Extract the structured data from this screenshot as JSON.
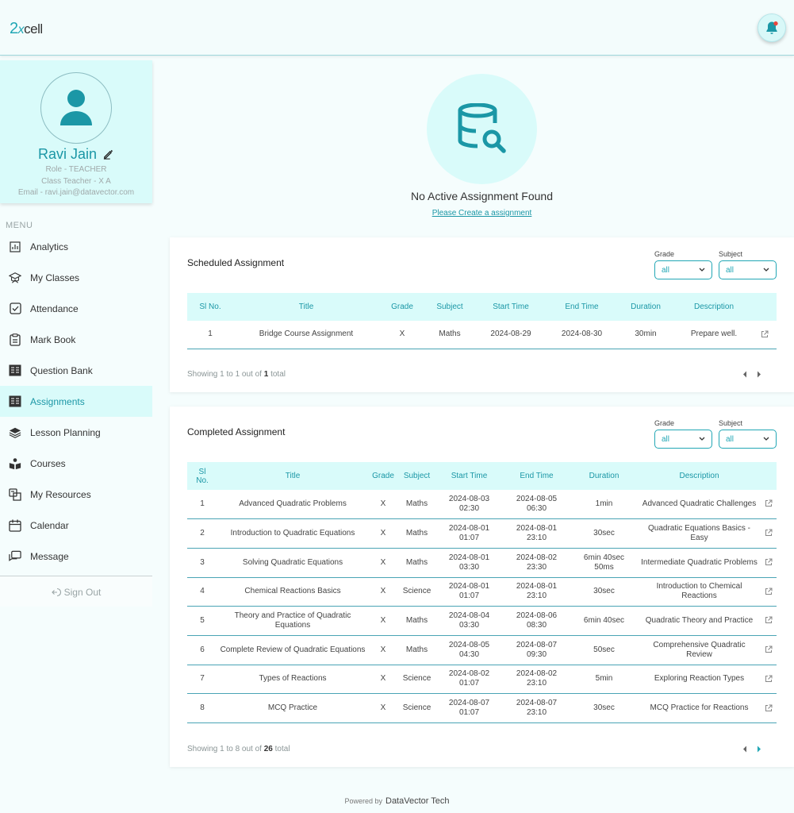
{
  "brand": {
    "logo_two": "2",
    "logo_x": "x",
    "logo_cell": "cell"
  },
  "header": {
    "notification_icon": "bell-icon"
  },
  "profile": {
    "name": "Ravi Jain",
    "role": "Role - TEACHER",
    "class_teacher": "Class Teacher - X A",
    "email": "Email - ravi.jain@datavector.com"
  },
  "menu": {
    "label": "MENU",
    "items": [
      {
        "label": "Analytics",
        "icon": "chart-icon"
      },
      {
        "label": "My Classes",
        "icon": "graduation-cap-icon"
      },
      {
        "label": "Attendance",
        "icon": "checkbox-icon"
      },
      {
        "label": "Mark Book",
        "icon": "clipboard-icon"
      },
      {
        "label": "Question Bank",
        "icon": "question-bank-icon"
      },
      {
        "label": "Assignments",
        "icon": "assignment-icon",
        "active": true
      },
      {
        "label": "Lesson Planning",
        "icon": "layers-icon"
      },
      {
        "label": "Courses",
        "icon": "book-reader-icon"
      },
      {
        "label": "My Resources",
        "icon": "resources-icon"
      },
      {
        "label": "Calendar",
        "icon": "calendar-icon"
      },
      {
        "label": "Message",
        "icon": "message-icon"
      }
    ],
    "sign_out": "Sign Out"
  },
  "active_assignment": {
    "empty_title": "No Active Assignment Found",
    "create_link": "Please Create a assignment"
  },
  "scheduled": {
    "title": "Scheduled Assignment",
    "grade_label": "Grade",
    "grade_value": "all",
    "subject_label": "Subject",
    "subject_value": "all",
    "headers": [
      "Sl No.",
      "Title",
      "Grade",
      "Subject",
      "Start Time",
      "End Time",
      "Duration",
      "Description"
    ],
    "rows": [
      [
        "1",
        "Bridge Course Assignment",
        "X",
        "Maths",
        "2024-08-29",
        "2024-08-30",
        "30min",
        "Prepare well."
      ]
    ],
    "showing_prefix": "Showing 1 to 1 out of",
    "showing_total": "1",
    "showing_suffix": "total"
  },
  "completed": {
    "title": "Completed Assignment",
    "grade_label": "Grade",
    "grade_value": "all",
    "subject_label": "Subject",
    "subject_value": "all",
    "headers": [
      "Sl No.",
      "Title",
      "Grade",
      "Subject",
      "Start Time",
      "End Time",
      "Duration",
      "Description"
    ],
    "rows": [
      [
        "1",
        "Advanced Quadratic Problems",
        "X",
        "Maths",
        "2024-08-03 02:30",
        "2024-08-05 06:30",
        "1min",
        "Advanced Quadratic Challenges"
      ],
      [
        "2",
        "Introduction to Quadratic Equations",
        "X",
        "Maths",
        "2024-08-01 01:07",
        "2024-08-01 23:10",
        "30sec",
        "Quadratic Equations Basics - Easy"
      ],
      [
        "3",
        "Solving Quadratic Equations",
        "X",
        "Maths",
        "2024-08-01 03:30",
        "2024-08-02 23:30",
        "6min 40sec 50ms",
        "Intermediate Quadratic Problems"
      ],
      [
        "4",
        "Chemical Reactions Basics",
        "X",
        "Science",
        "2024-08-01 01:07",
        "2024-08-01 23:10",
        "30sec",
        "Introduction to Chemical Reactions"
      ],
      [
        "5",
        "Theory and Practice of Quadratic Equations",
        "X",
        "Maths",
        "2024-08-04 03:30",
        "2024-08-06 08:30",
        "6min 40sec",
        "Quadratic Theory and Practice"
      ],
      [
        "6",
        "Complete Review of Quadratic Equations",
        "X",
        "Maths",
        "2024-08-05 04:30",
        "2024-08-07 09:30",
        "50sec",
        "Comprehensive Quadratic Review"
      ],
      [
        "7",
        "Types of Reactions",
        "X",
        "Science",
        "2024-08-02 01:07",
        "2024-08-02 23:10",
        "5min",
        "Exploring Reaction Types"
      ],
      [
        "8",
        "MCQ Practice",
        "X",
        "Science",
        "2024-08-07 01:07",
        "2024-08-07 23:10",
        "30sec",
        "MCQ Practice for Reactions"
      ]
    ],
    "showing_prefix": "Showing 1 to 8 out of",
    "showing_total": "26",
    "showing_suffix": "total"
  },
  "footer": {
    "powered_by": "Powered by",
    "company": "DataVector Tech"
  },
  "colors": {
    "accent": "#22a7b5",
    "panel": "#d9fbfa",
    "notification_dot": "#e8463e"
  }
}
